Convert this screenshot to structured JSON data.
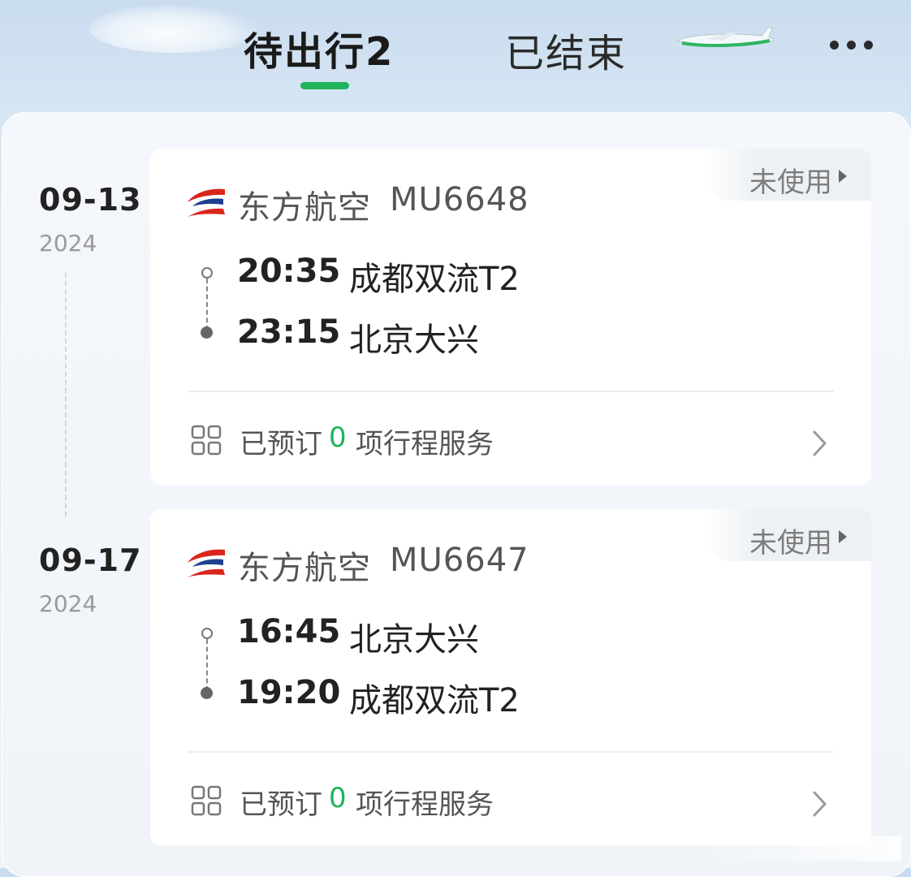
{
  "header": {
    "tab_upcoming": "待出行2",
    "tab_ended": "已结束",
    "colors": {
      "accent": "#1fb35a"
    },
    "icons": {
      "plane": "airplane-icon",
      "more": "more-icon"
    }
  },
  "trips": [
    {
      "date": "09-13",
      "year": "2024",
      "status": "未使用",
      "airline": "东方航空",
      "flight_no": "MU6648",
      "dep_time": "20:35",
      "dep_place": "成都双流T2",
      "arr_time": "23:15",
      "arr_place": "北京大兴",
      "service_booked": "已预订",
      "service_count": "0",
      "service_label": "项行程服务"
    },
    {
      "date": "09-17",
      "year": "2024",
      "status": "未使用",
      "airline": "东方航空",
      "flight_no": "MU6647",
      "dep_time": "16:45",
      "dep_place": "北京大兴",
      "arr_time": "19:20",
      "arr_place": "成都双流T2",
      "service_booked": "已预订",
      "service_count": "0",
      "service_label": "项行程服务"
    }
  ]
}
